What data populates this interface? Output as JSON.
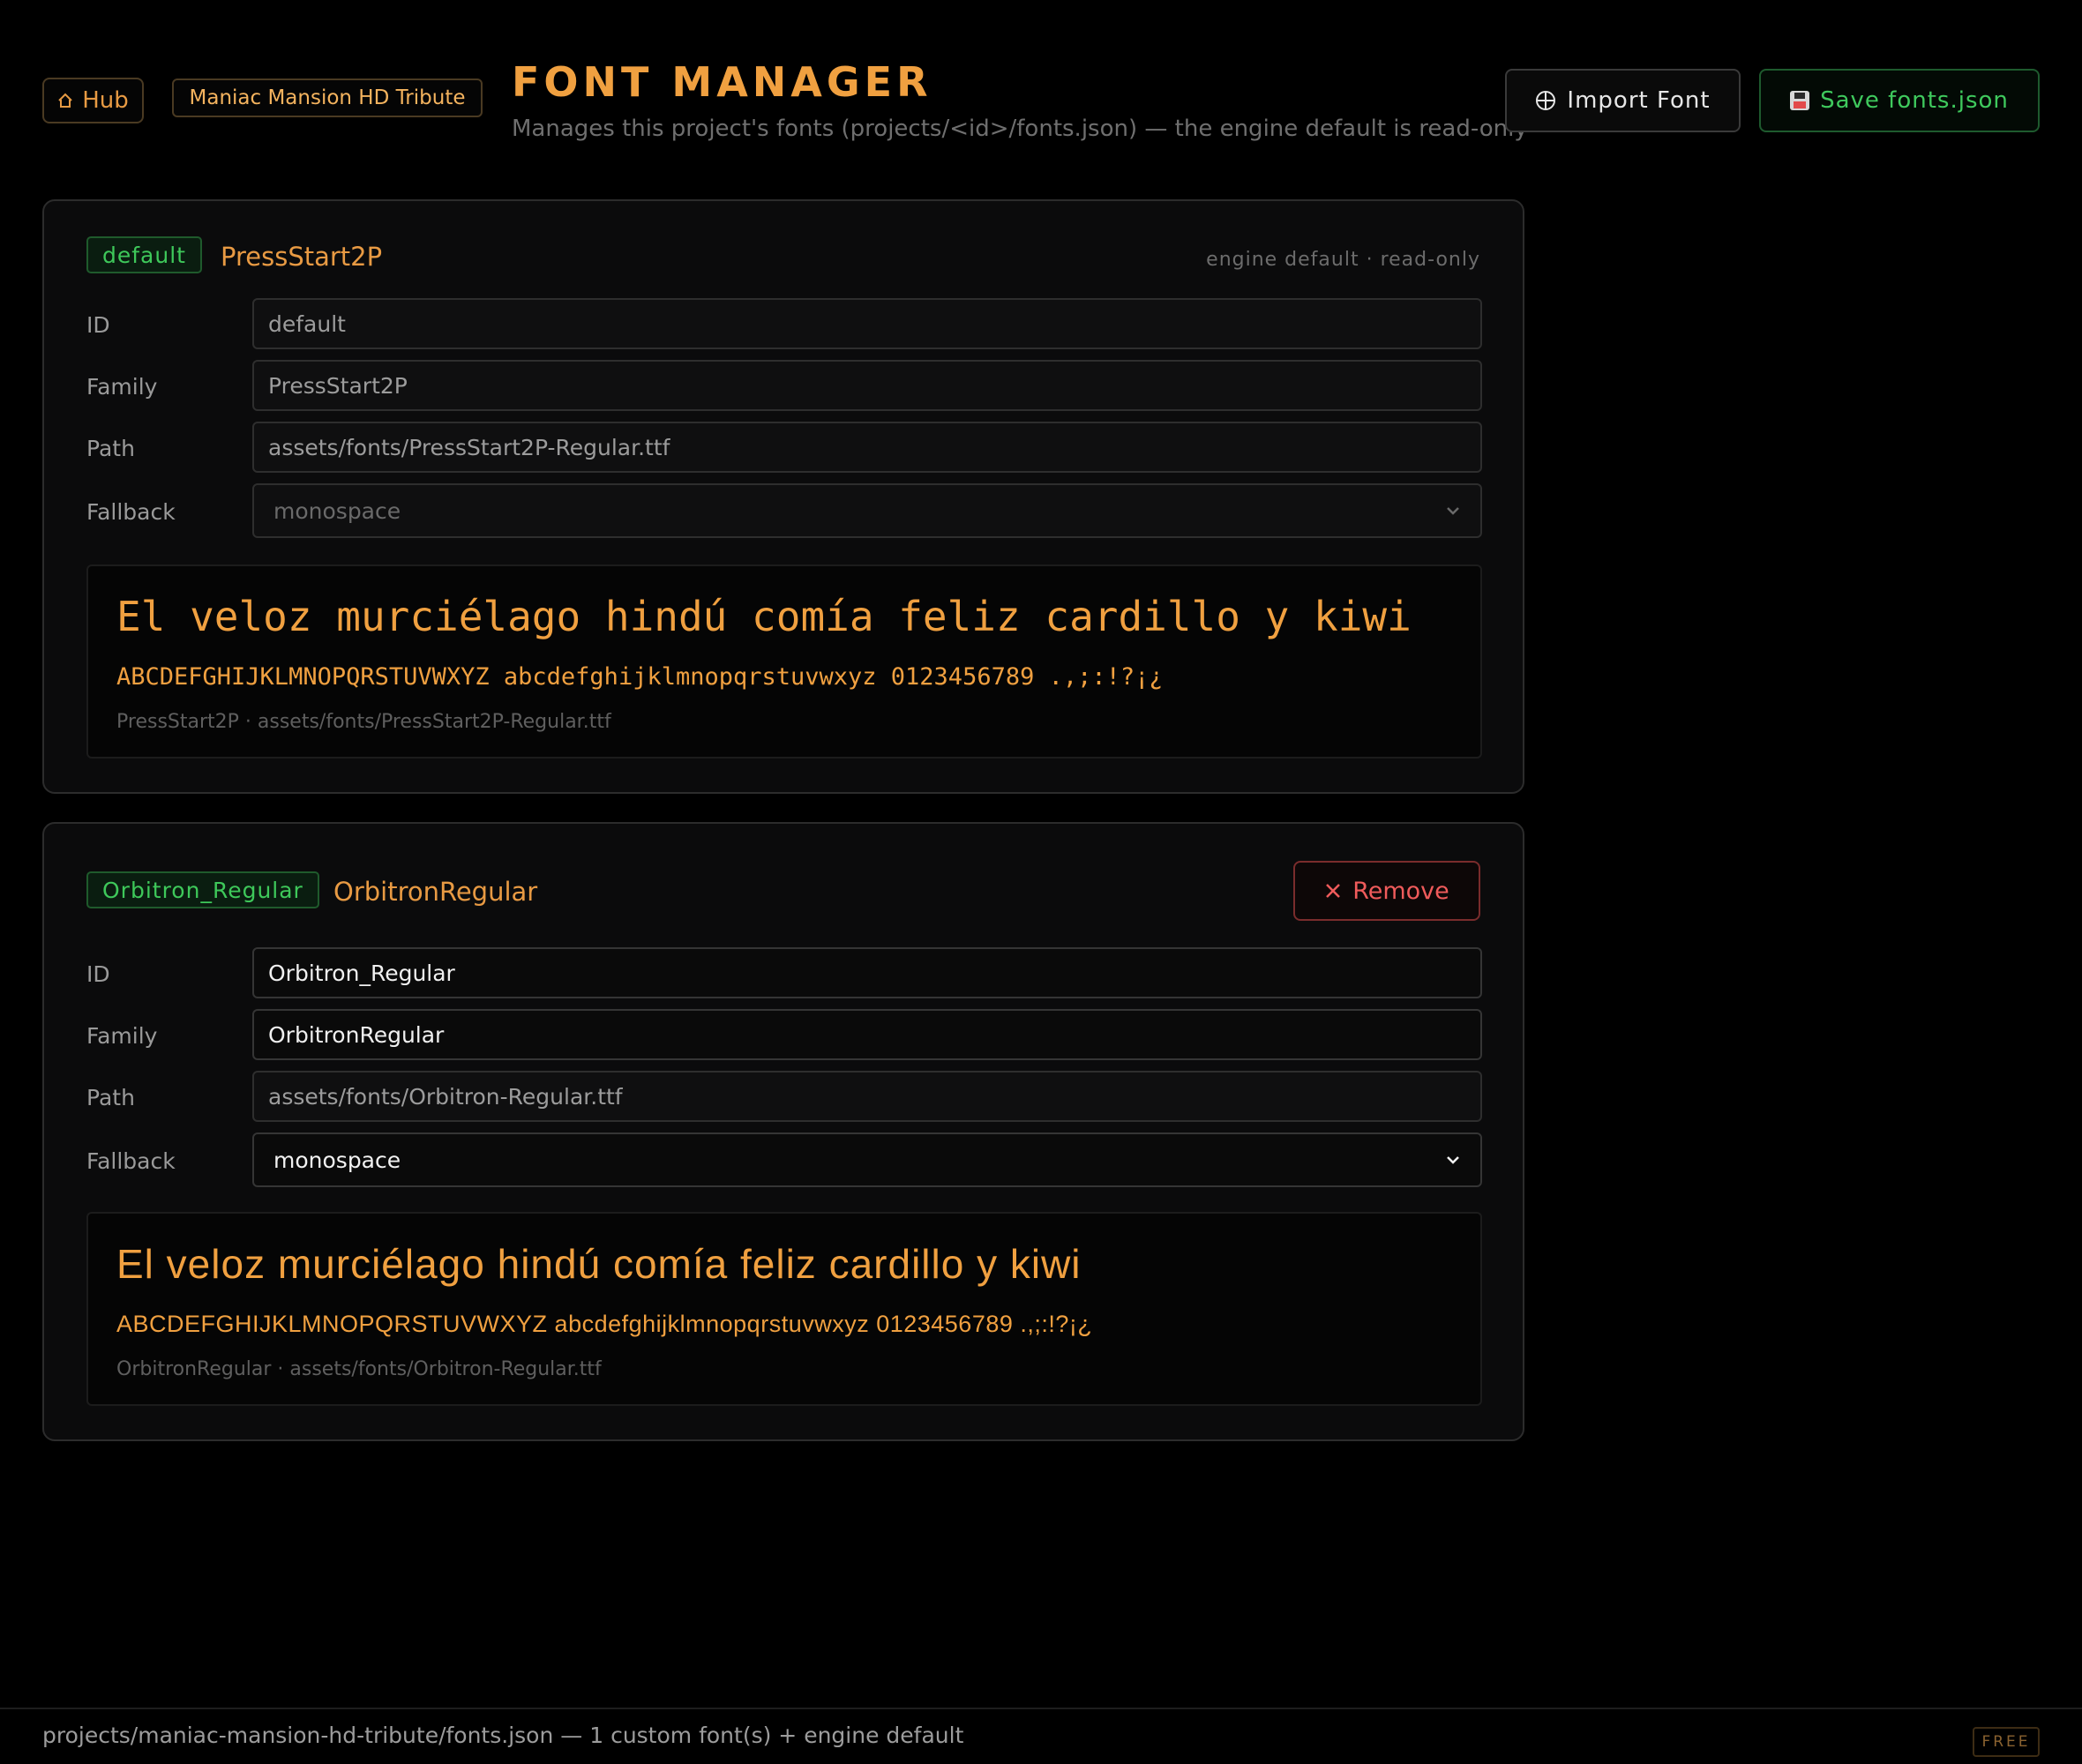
{
  "header": {
    "hub_label": "Hub",
    "hub_icon": "home-icon",
    "project_name": "Maniac Mansion HD Tribute",
    "title": "FONT MANAGER",
    "subtitle": "Manages this project's fonts (projects/<id>/fonts.json) — the engine default is read-only",
    "import_label": "Import Font",
    "import_icon": "add-circle-icon",
    "save_label": "Save fonts.json",
    "save_icon": "floppy-disk-icon"
  },
  "labels": {
    "id": "ID",
    "family": "Family",
    "path": "Path",
    "fallback": "Fallback"
  },
  "fonts": [
    {
      "id": "default",
      "family": "PressStart2P",
      "path": "assets/fonts/PressStart2P-Regular.ttf",
      "fallback": "monospace",
      "read_only": true,
      "note": "engine default · read-only",
      "preview_sentence": "El veloz murciélago hindú comía feliz cardillo y kiwi",
      "preview_charset": "ABCDEFGHIJKLMNOPQRSTUVWXYZ abcdefghijklmnopqrstuvwxyz 0123456789 .,;:!?¡¿",
      "preview_caption": "PressStart2P · assets/fonts/PressStart2P-Regular.ttf"
    },
    {
      "id": "Orbitron_Regular",
      "family": "OrbitronRegular",
      "path": "assets/fonts/Orbitron-Regular.ttf",
      "fallback": "monospace",
      "read_only": false,
      "remove_label": "Remove",
      "preview_sentence": "El veloz murciélago hindú comía feliz cardillo y kiwi",
      "preview_charset": "ABCDEFGHIJKLMNOPQRSTUVWXYZ abcdefghijklmnopqrstuvwxyz 0123456789 .,;:!?¡¿",
      "preview_caption": "OrbitronRegular · assets/fonts/Orbitron-Regular.ttf"
    }
  ],
  "footer": {
    "path_summary": "projects/maniac-mansion-hd-tribute/fonts.json — 1 custom font(s) + engine default",
    "plan_badge": "FREE"
  },
  "colors": {
    "accent": "#f0a040",
    "success": "#3ec85a",
    "danger": "#ef5b5b",
    "background": "#000000",
    "card": "#0b0b0c"
  }
}
